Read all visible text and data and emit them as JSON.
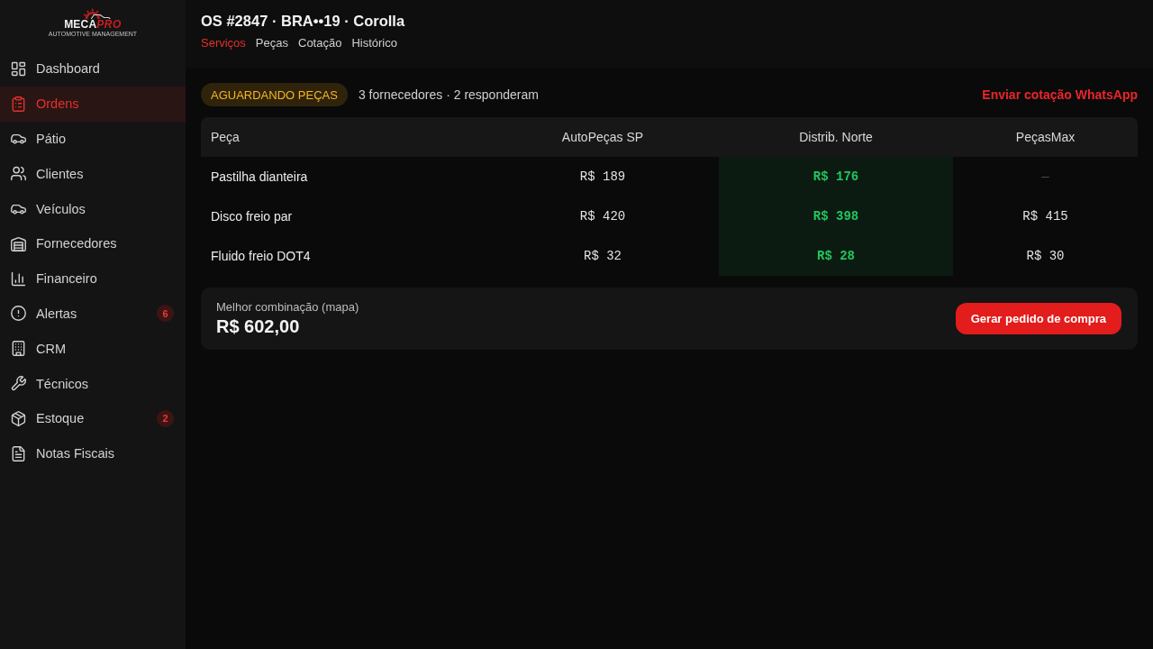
{
  "sidebar": {
    "logo": {
      "name": "MECA",
      "name_accent": "PRO",
      "tagline": "AUTOMOTIVE MANAGEMENT"
    },
    "items": [
      {
        "label": "Dashboard",
        "selected": false
      },
      {
        "label": "Ordens",
        "selected": true
      },
      {
        "label": "Pátio",
        "selected": false
      },
      {
        "label": "Clientes",
        "selected": false
      },
      {
        "label": "Veículos",
        "selected": false
      },
      {
        "label": "Fornecedores",
        "selected": false
      },
      {
        "label": "Financeiro",
        "selected": false
      },
      {
        "label": "Alertas",
        "selected": false,
        "badge": "6"
      },
      {
        "label": "CRM",
        "selected": false
      },
      {
        "label": "Técnicos",
        "selected": false
      },
      {
        "label": "Estoque",
        "selected": false,
        "badge": "2"
      },
      {
        "label": "Notas Fiscais",
        "selected": false
      }
    ]
  },
  "header": {
    "title": "OS #2847 · BRA••19 · Corolla",
    "tabs": [
      {
        "label": "Serviços",
        "selected": true
      },
      {
        "label": "Peças",
        "selected": false
      },
      {
        "label": "Cotação",
        "selected": false
      },
      {
        "label": "Histórico",
        "selected": false
      }
    ]
  },
  "quote_bar": {
    "status": "AGUARDANDO PEÇAS",
    "summary": "3 fornecedores · 2 responderam",
    "action": "Enviar cotação WhatsApp"
  },
  "quote_table": {
    "part_header": "Peça",
    "suppliers": [
      {
        "name": "AutoPeças SP",
        "recommended": false
      },
      {
        "name": "Distrib. Norte",
        "recommended": true
      },
      {
        "name": "PeçasMax",
        "recommended": false
      }
    ],
    "parts": [
      {
        "name": "Pastilha dianteira",
        "prices": [
          {
            "value": "R$ 189",
            "best": false,
            "available": true
          },
          {
            "value": "R$ 176",
            "best": true,
            "available": true
          },
          {
            "value": "—",
            "best": false,
            "available": false
          }
        ]
      },
      {
        "name": "Disco freio par",
        "prices": [
          {
            "value": "R$ 420",
            "best": false,
            "available": true
          },
          {
            "value": "R$ 398",
            "best": true,
            "available": true
          },
          {
            "value": "R$ 415",
            "best": false,
            "available": true
          }
        ]
      },
      {
        "name": "Fluido freio DOT4",
        "prices": [
          {
            "value": "R$ 32",
            "best": false,
            "available": true
          },
          {
            "value": "R$ 28",
            "best": true,
            "available": true
          },
          {
            "value": "R$ 30",
            "best": false,
            "available": true
          }
        ]
      }
    ]
  },
  "summary": {
    "label": "Melhor combinação (mapa)",
    "total": "R$ 602,00",
    "action": "Gerar pedido de compra"
  }
}
